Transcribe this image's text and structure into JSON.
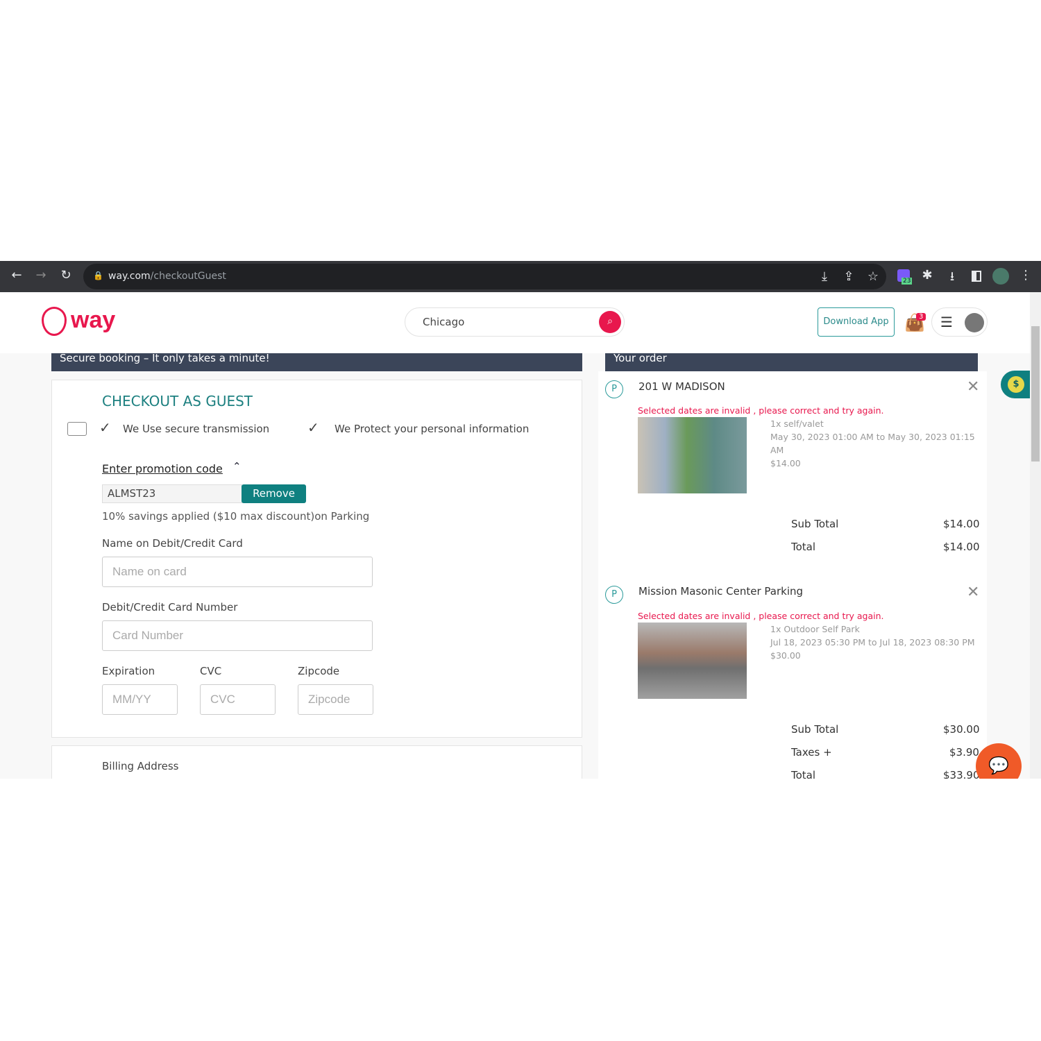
{
  "browser": {
    "url_host": "way.com",
    "url_path": "/checkoutGuest",
    "extension_badge": "23"
  },
  "header": {
    "logo": "way",
    "search_value": "Chicago",
    "download_label": "Download App",
    "cart_count": "3"
  },
  "checkout": {
    "banner": "Secure booking – It only takes a minute!",
    "title": "CHECKOUT AS GUEST",
    "assurances": [
      "We Use secure transmission",
      "We Protect your personal information"
    ],
    "promo_link": "Enter promotion code",
    "promo_value": "ALMST23",
    "remove_label": "Remove",
    "promo_note": "10% savings applied ($10 max discount)on Parking",
    "name_label": "Name on Debit/Credit Card",
    "name_placeholder": "Name on card",
    "card_label": "Debit/Credit Card Number",
    "card_placeholder": "Card Number",
    "exp_label": "Expiration",
    "exp_placeholder": "MM/YY",
    "cvc_label": "CVC",
    "cvc_placeholder": "CVC",
    "zip_label": "Zipcode",
    "zip_placeholder": "Zipcode",
    "billing_label": "Billing Address"
  },
  "order": {
    "banner": "Your order",
    "items": [
      {
        "name": "201 W MADISON",
        "error": "Selected dates are invalid , please correct and try again.",
        "qty": "1x self/valet",
        "dates": "May 30, 2023 01:00 AM to May 30, 2023 01:15 AM",
        "price": "$14.00",
        "subtotal_label": "Sub Total",
        "subtotal": "$14.00",
        "total_label": "Total",
        "total": "$14.00"
      },
      {
        "name": "Mission Masonic Center Parking",
        "error": "Selected dates are invalid , please correct and try again.",
        "qty": "1x Outdoor Self Park",
        "dates": "Jul 18, 2023 05:30 PM to Jul 18, 2023 08:30 PM",
        "price": "$30.00",
        "subtotal_label": "Sub Total",
        "subtotal": "$30.00",
        "taxes_label": "Taxes +",
        "taxes": "$3.90",
        "total_label": "Total",
        "total": "$33.90"
      }
    ]
  },
  "colors": {
    "brand": "#e8174d",
    "teal": "#1d8080",
    "banner": "#3b4559",
    "chat": "#f05a28"
  }
}
